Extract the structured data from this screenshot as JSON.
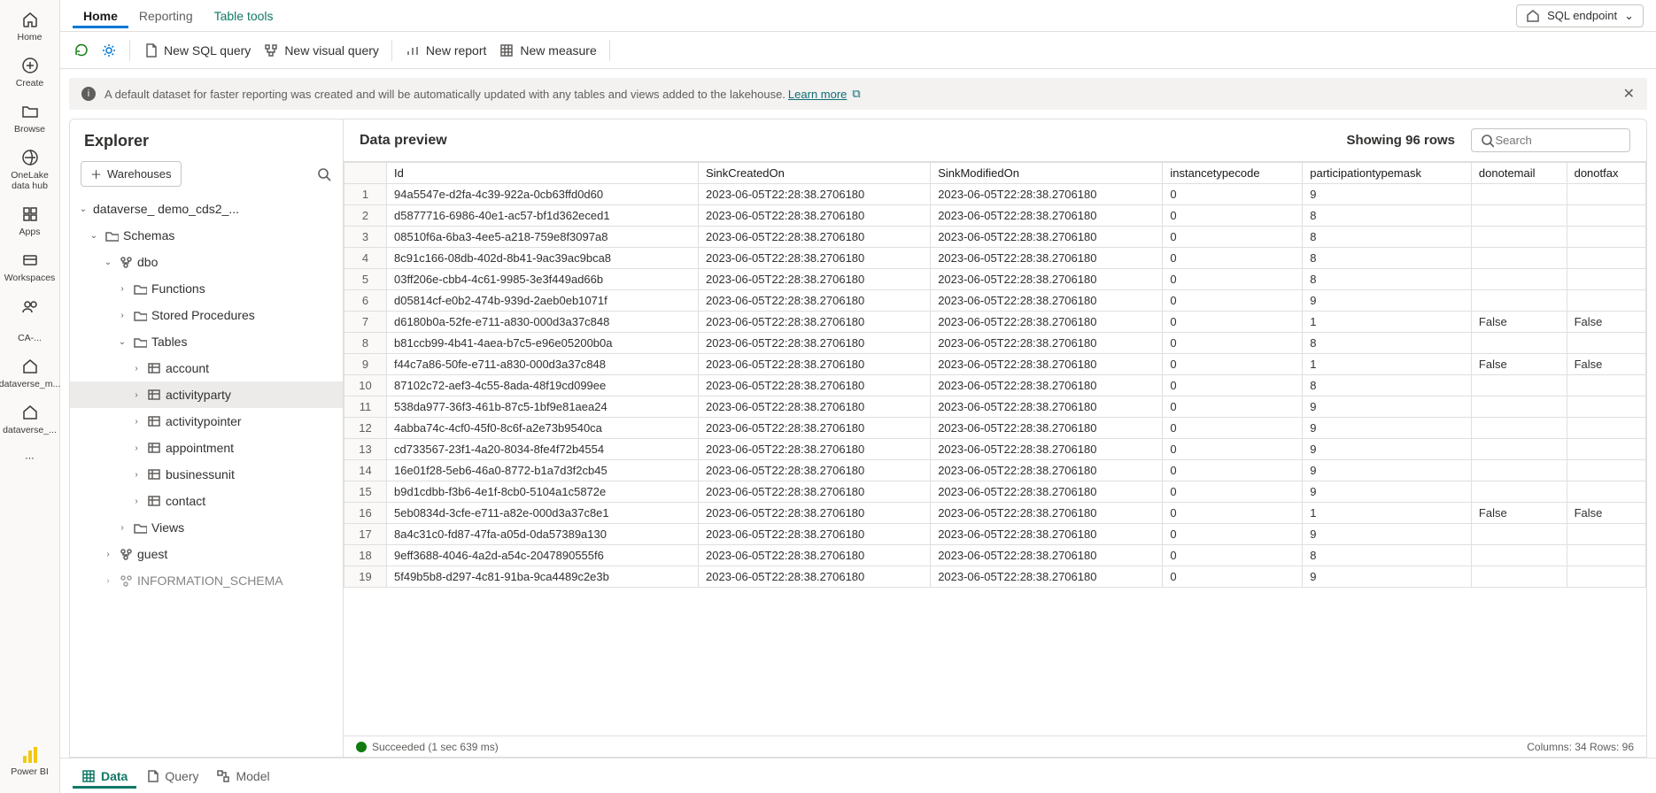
{
  "rail": {
    "home": "Home",
    "create": "Create",
    "browse": "Browse",
    "onelake": "OneLake data hub",
    "apps": "Apps",
    "workspaces": "Workspaces",
    "ca": "CA-...",
    "dvm": "dataverse_m...",
    "dv": "dataverse_...",
    "pbi": "Power BI"
  },
  "tabs": {
    "home": "Home",
    "reporting": "Reporting",
    "tools": "Table tools"
  },
  "sqlendpoint": "SQL endpoint",
  "cmds": {
    "refresh": "",
    "settings": "",
    "newSql": "New SQL query",
    "newVisual": "New visual query",
    "newReport": "New report",
    "newMeasure": "New measure"
  },
  "infobar": {
    "text": "A default dataset for faster reporting was created and will be automatically updated with any tables and views added to the lakehouse.",
    "learn": "Learn more"
  },
  "explorer": {
    "title": "Explorer",
    "warehouses": "Warehouses",
    "root": "dataverse_             demo_cds2_...",
    "schemas": "Schemas",
    "dbo": "dbo",
    "functions": "Functions",
    "stored": "Stored Procedures",
    "tables": "Tables",
    "tlist": [
      "account",
      "activityparty",
      "activitypointer",
      "appointment",
      "businessunit",
      "contact"
    ],
    "views": "Views",
    "guest": "guest",
    "infoSchema": "INFORMATION_SCHEMA"
  },
  "preview": {
    "title": "Data preview",
    "showing": "Showing 96 rows",
    "searchPlaceholder": "Search",
    "headers": [
      "Id",
      "SinkCreatedOn",
      "SinkModifiedOn",
      "instancetypecode",
      "participationtypemask",
      "donotemail",
      "donotfax"
    ],
    "rows": [
      [
        "94a5547e-d2fa-4c39-922a-0cb63ffd0d60",
        "2023-06-05T22:28:38.2706180",
        "2023-06-05T22:28:38.2706180",
        "0",
        "9",
        "",
        ""
      ],
      [
        "d5877716-6986-40e1-ac57-bf1d362eced1",
        "2023-06-05T22:28:38.2706180",
        "2023-06-05T22:28:38.2706180",
        "0",
        "8",
        "",
        ""
      ],
      [
        "08510f6a-6ba3-4ee5-a218-759e8f3097a8",
        "2023-06-05T22:28:38.2706180",
        "2023-06-05T22:28:38.2706180",
        "0",
        "8",
        "",
        ""
      ],
      [
        "8c91c166-08db-402d-8b41-9ac39ac9bca8",
        "2023-06-05T22:28:38.2706180",
        "2023-06-05T22:28:38.2706180",
        "0",
        "8",
        "",
        ""
      ],
      [
        "03ff206e-cbb4-4c61-9985-3e3f449ad66b",
        "2023-06-05T22:28:38.2706180",
        "2023-06-05T22:28:38.2706180",
        "0",
        "8",
        "",
        ""
      ],
      [
        "d05814cf-e0b2-474b-939d-2aeb0eb1071f",
        "2023-06-05T22:28:38.2706180",
        "2023-06-05T22:28:38.2706180",
        "0",
        "9",
        "",
        ""
      ],
      [
        "d6180b0a-52fe-e711-a830-000d3a37c848",
        "2023-06-05T22:28:38.2706180",
        "2023-06-05T22:28:38.2706180",
        "0",
        "1",
        "False",
        "False"
      ],
      [
        "b81ccb99-4b41-4aea-b7c5-e96e05200b0a",
        "2023-06-05T22:28:38.2706180",
        "2023-06-05T22:28:38.2706180",
        "0",
        "8",
        "",
        ""
      ],
      [
        "f44c7a86-50fe-e711-a830-000d3a37c848",
        "2023-06-05T22:28:38.2706180",
        "2023-06-05T22:28:38.2706180",
        "0",
        "1",
        "False",
        "False"
      ],
      [
        "87102c72-aef3-4c55-8ada-48f19cd099ee",
        "2023-06-05T22:28:38.2706180",
        "2023-06-05T22:28:38.2706180",
        "0",
        "8",
        "",
        ""
      ],
      [
        "538da977-36f3-461b-87c5-1bf9e81aea24",
        "2023-06-05T22:28:38.2706180",
        "2023-06-05T22:28:38.2706180",
        "0",
        "9",
        "",
        ""
      ],
      [
        "4abba74c-4cf0-45f0-8c6f-a2e73b9540ca",
        "2023-06-05T22:28:38.2706180",
        "2023-06-05T22:28:38.2706180",
        "0",
        "9",
        "",
        ""
      ],
      [
        "cd733567-23f1-4a20-8034-8fe4f72b4554",
        "2023-06-05T22:28:38.2706180",
        "2023-06-05T22:28:38.2706180",
        "0",
        "9",
        "",
        ""
      ],
      [
        "16e01f28-5eb6-46a0-8772-b1a7d3f2cb45",
        "2023-06-05T22:28:38.2706180",
        "2023-06-05T22:28:38.2706180",
        "0",
        "9",
        "",
        ""
      ],
      [
        "b9d1cdbb-f3b6-4e1f-8cb0-5104a1c5872e",
        "2023-06-05T22:28:38.2706180",
        "2023-06-05T22:28:38.2706180",
        "0",
        "9",
        "",
        ""
      ],
      [
        "5eb0834d-3cfe-e711-a82e-000d3a37c8e1",
        "2023-06-05T22:28:38.2706180",
        "2023-06-05T22:28:38.2706180",
        "0",
        "1",
        "False",
        "False"
      ],
      [
        "8a4c31c0-fd87-47fa-a05d-0da57389a130",
        "2023-06-05T22:28:38.2706180",
        "2023-06-05T22:28:38.2706180",
        "0",
        "9",
        "",
        ""
      ],
      [
        "9eff3688-4046-4a2d-a54c-2047890555f6",
        "2023-06-05T22:28:38.2706180",
        "2023-06-05T22:28:38.2706180",
        "0",
        "8",
        "",
        ""
      ],
      [
        "5f49b5b8-d297-4c81-91ba-9ca4489c2e3b",
        "2023-06-05T22:28:38.2706180",
        "2023-06-05T22:28:38.2706180",
        "0",
        "9",
        "",
        ""
      ]
    ],
    "status": "Succeeded (1 sec 639 ms)",
    "colsRows": "Columns: 34  Rows: 96"
  },
  "bottom": {
    "data": "Data",
    "query": "Query",
    "model": "Model"
  }
}
